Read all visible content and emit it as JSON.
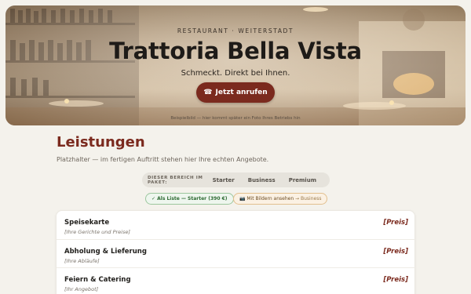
{
  "hero": {
    "eyebrow": "RESTAURANT · WEITERSTADT",
    "title": "Trattoria Bella Vista",
    "subtitle": "Schmeckt. Direkt bei Ihnen.",
    "call_icon": "phone-icon",
    "call_label": "Jetzt anrufen",
    "caption": "Beispielbild — hier kommt später ein Foto Ihres Betriebs hin"
  },
  "services": {
    "title": "Leistungen",
    "subtitle": "Platzhalter — im fertigen Auftritt stehen hier Ihre echten Angebote.",
    "package_label": "DIESER BEREICH IM PAKET:",
    "packages": [
      "Starter",
      "Business",
      "Premium"
    ],
    "chip_list": "✓ Als Liste — Starter (390 €)",
    "chip_images_icon": "📷",
    "chip_images_text": "Mit Bildern ansehen",
    "chip_images_suffix": "→ Business",
    "items": [
      {
        "name": "Speisekarte",
        "desc": "[Ihre Gerichte und Preise]",
        "price": "[Preis]"
      },
      {
        "name": "Abholung & Lieferung",
        "desc": "[Ihre Abläufe]",
        "price": "[Preis]"
      },
      {
        "name": "Feiern & Catering",
        "desc": "[Ihr Angebot]",
        "price": "[Preis]"
      }
    ]
  },
  "colors": {
    "accent": "#7b2a1e",
    "background": "#f4f2ec"
  }
}
